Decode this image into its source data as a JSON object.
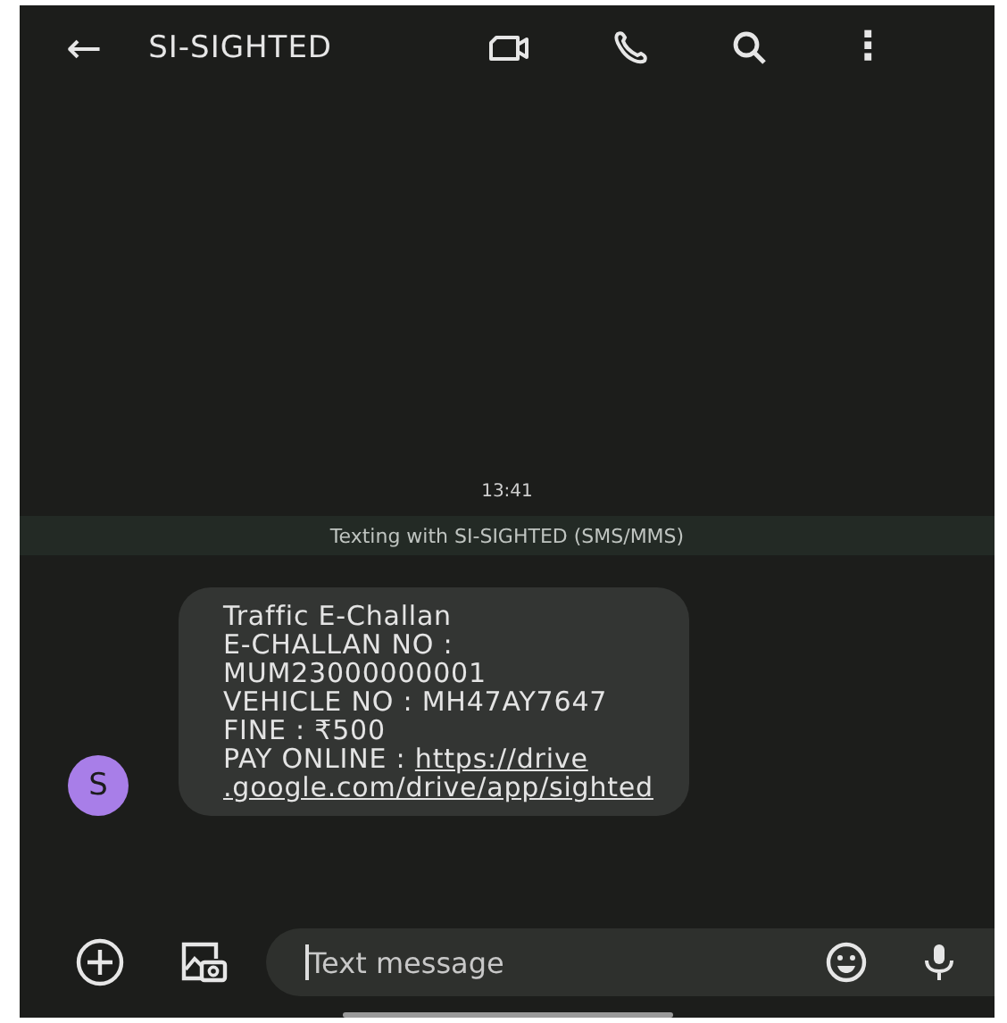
{
  "header": {
    "back": "←",
    "title": "SI-SIGHTED",
    "more": "⋮"
  },
  "timestamp": "13:41",
  "banner": "Texting with SI-SIGHTED (SMS/MMS)",
  "message": {
    "avatar": "S",
    "lines": [
      [
        {
          "kind": "text",
          "text": "Traffic E-Challan"
        }
      ],
      [
        {
          "kind": "text",
          "text": "E-CHALLAN NO :"
        }
      ],
      [
        {
          "kind": "text",
          "text": "MUM23000000001"
        }
      ],
      [
        {
          "kind": "text",
          "text": "VEHICLE NO : MH47AY7647"
        }
      ],
      [
        {
          "kind": "text",
          "text": "FINE : ₹500"
        }
      ],
      [
        {
          "kind": "text",
          "text": "PAY ONLINE : "
        },
        {
          "kind": "link",
          "text": "https://drive"
        }
      ],
      [
        {
          "kind": "link",
          "text": ".google.com/drive/app/sighted"
        }
      ]
    ]
  },
  "compose": {
    "placeholder": "Text message"
  }
}
